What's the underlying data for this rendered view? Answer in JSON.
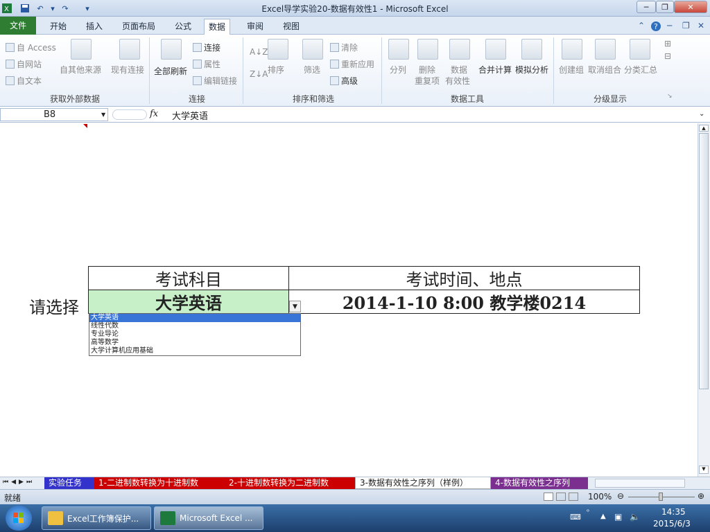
{
  "window": {
    "title": "Excel导学实验20-数据有效性1  -  Microsoft Excel"
  },
  "ribbon_tabs": [
    "文件",
    "开始",
    "插入",
    "页面布局",
    "公式",
    "数据",
    "审阅",
    "视图"
  ],
  "ribbon": {
    "get_external": {
      "access": "自 Access",
      "web": "自网站",
      "text": "自文本",
      "other": "自其他来源",
      "existing": "现有连接",
      "title": "获取外部数据"
    },
    "connections": {
      "refresh_all": "全部刷新",
      "connections": "连接",
      "properties": "属性",
      "edit_links": "编辑链接",
      "title": "连接"
    },
    "sort_filter": {
      "sort": "排序",
      "filter": "筛选",
      "clear": "清除",
      "reapply": "重新应用",
      "advanced": "高级",
      "title": "排序和筛选"
    },
    "data_tools": {
      "split": "分列",
      "remove_dup_1": "删除",
      "remove_dup_2": "重复项",
      "validation_1": "数据",
      "validation_2": "有效性",
      "consolidate": "合并计算",
      "whatif": "模拟分析",
      "title": "数据工具"
    },
    "outline": {
      "group": "创建组",
      "ungroup": "取消组合",
      "subtotal": "分类汇总",
      "title": "分级显示"
    }
  },
  "formula_bar": {
    "name_box": "B8",
    "fx": "fx",
    "formula": "大学英语"
  },
  "sheet": {
    "header_subject": "考试科目",
    "header_time": "考试时间、地点",
    "prompt": "请选择",
    "selected_subject": "大学英语",
    "time_place": "2014-1-10   8:00   教学楼0214",
    "dropdown_items": [
      "大学英语",
      "线性代数",
      "专业导论",
      "高等数学",
      "大学计算机应用基础"
    ]
  },
  "sheet_tabs": [
    {
      "label": "实验任务",
      "color": "#3333cc"
    },
    {
      "label": "1-二进制数转换为十进制数",
      "color": "#cc0000"
    },
    {
      "label": "2-十进制数转换为二进制数",
      "color": "#cc0000"
    },
    {
      "label": "3-数据有效性之序列（样例）",
      "color": "#ffffff"
    },
    {
      "label": "4-数据有效性之序列",
      "color": "#7b2f8f"
    }
  ],
  "status": {
    "ready": "就绪",
    "zoom": "100%"
  },
  "taskbar": {
    "item1": "Excel工作簿保护...",
    "item2": "Microsoft Excel ...",
    "time": "14:35",
    "date": "2015/6/3"
  }
}
